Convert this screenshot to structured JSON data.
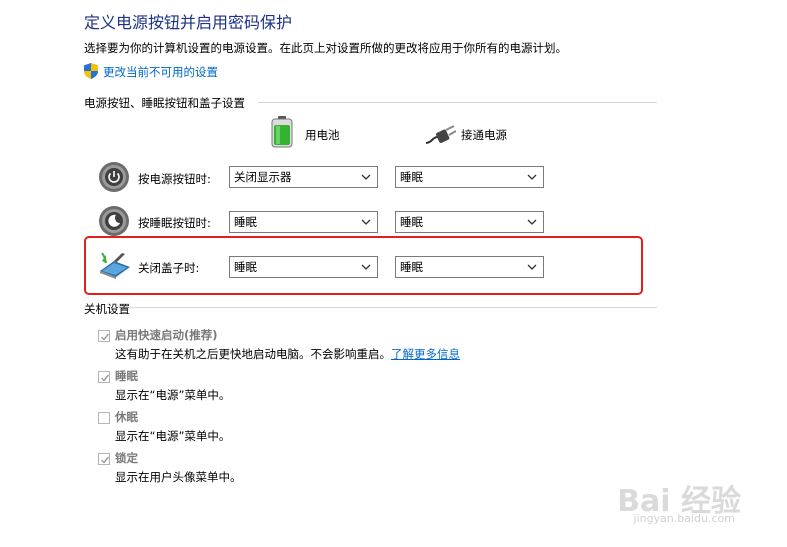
{
  "header": {
    "title": "定义电源按钮并启用密码保护",
    "description": "选择要为你的计算机设置的电源设置。在此页上对设置所做的更改将应用于你所有的电源计划。",
    "change_link": "更改当前不可用的设置"
  },
  "power_section": {
    "title": "电源按钮、睡眠按钮和盖子设置",
    "columns": {
      "battery": "用电池",
      "plugged": "接通电源"
    },
    "rows": [
      {
        "label": "按电源按钮时:",
        "battery": "关闭显示器",
        "plugged": "睡眠"
      },
      {
        "label": "按睡眠按钮时:",
        "battery": "睡眠",
        "plugged": "睡眠"
      },
      {
        "label": "关闭盖子时:",
        "battery": "睡眠",
        "plugged": "睡眠"
      }
    ]
  },
  "shutdown_section": {
    "title": "关机设置",
    "items": [
      {
        "label": "启用快速启动(推荐)",
        "desc": "这有助于在关机之后更快地启动电脑。不会影响重启。",
        "link": "了解更多信息",
        "checked": true
      },
      {
        "label": "睡眠",
        "desc": "显示在“电源”菜单中。",
        "checked": true
      },
      {
        "label": "休眠",
        "desc": "显示在“电源”菜单中。",
        "checked": false
      },
      {
        "label": "锁定",
        "desc": "显示在用户头像菜单中。",
        "checked": true
      }
    ]
  },
  "watermark": {
    "main": "Bai 经验",
    "sub": "jingyan.baidu.com"
  },
  "colors": {
    "title": "#1e3287",
    "link": "#0066cc",
    "highlight": "#e0201b",
    "disabled_text": "#7a7a7a"
  }
}
